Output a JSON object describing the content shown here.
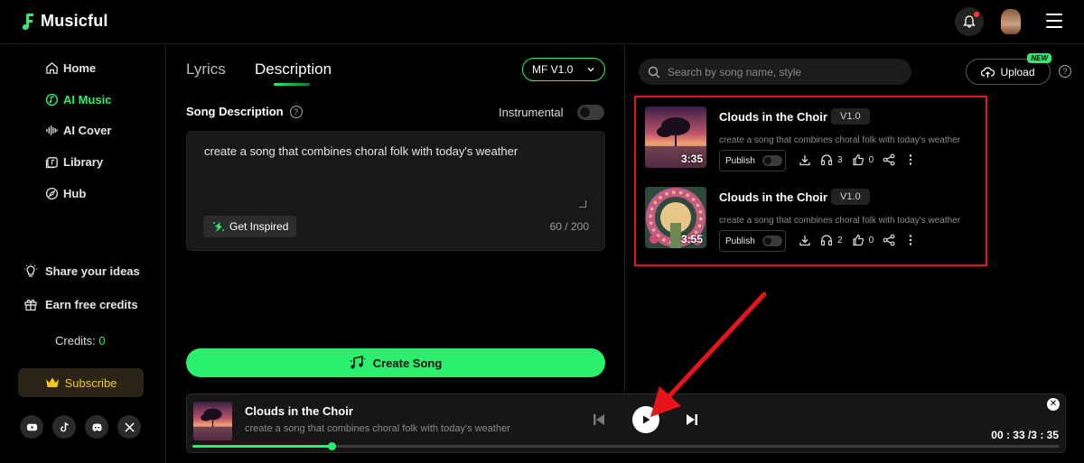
{
  "app": {
    "name": "Musicful"
  },
  "sidebar": {
    "items": [
      {
        "label": "Home",
        "icon": "home-icon",
        "active": false
      },
      {
        "label": "AI Music",
        "icon": "music-disc-icon",
        "active": true
      },
      {
        "label": "AI Cover",
        "icon": "waveform-icon",
        "active": false
      },
      {
        "label": "Library",
        "icon": "library-icon",
        "active": false
      },
      {
        "label": "Hub",
        "icon": "compass-icon",
        "active": false
      }
    ],
    "share_ideas": "Share your ideas",
    "earn_credits": "Earn free credits",
    "credits_label": "Credits:",
    "credits_value": "0",
    "subscribe": "Subscribe"
  },
  "tabs": [
    {
      "label": "Lyrics",
      "active": false
    },
    {
      "label": "Description",
      "active": true
    }
  ],
  "model_select": {
    "value": "MF V1.0"
  },
  "form": {
    "song_description_label": "Song Description",
    "help": "?",
    "instrumental_label": "Instrumental",
    "description_value": "create a song that combines choral folk with today's weather",
    "get_inspired": "Get Inspired",
    "counter": "60 / 200",
    "create_song": "Create Song"
  },
  "search": {
    "placeholder": "Search by song name, style"
  },
  "upload": {
    "label": "Upload",
    "badge": "NEW"
  },
  "songs": [
    {
      "title": "Clouds in the Choir",
      "version": "V1.0",
      "description": "create a song that combines choral folk with today's weather",
      "duration": "3:35",
      "publish": "Publish",
      "listens": "3",
      "likes": "0"
    },
    {
      "title": "Clouds in the Choir",
      "version": "V1.0",
      "description": "create a song that combines choral folk with today's weather",
      "duration": "3:55",
      "publish": "Publish",
      "listens": "2",
      "likes": "0"
    }
  ],
  "player": {
    "title": "Clouds in the Choir",
    "description": "create a song that combines choral folk with today's weather",
    "time": "00 : 33 /3 : 35",
    "progress_fraction": 0.16
  },
  "colors": {
    "accent": "#2bf06d",
    "highlight": "#e8141b",
    "subscribe": "#f5c518"
  }
}
